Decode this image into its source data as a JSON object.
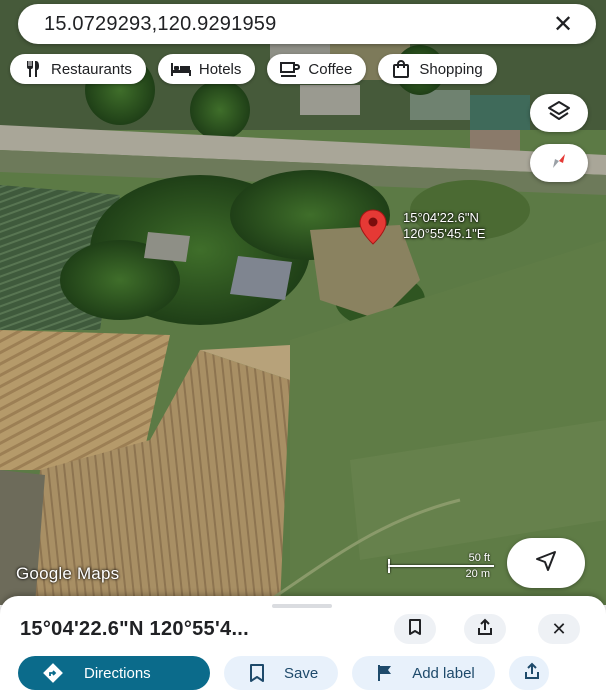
{
  "search": {
    "query": "15.0729293,120.9291959"
  },
  "chips": [
    {
      "label": "Restaurants",
      "icon": "fork-knife-icon"
    },
    {
      "label": "Hotels",
      "icon": "bed-icon"
    },
    {
      "label": "Coffee",
      "icon": "coffee-cup-icon"
    },
    {
      "label": "Shopping",
      "icon": "shopping-bag-icon"
    }
  ],
  "marker": {
    "lat_dms": "15°04'22.6\"N",
    "lng_dms": "120°55'45.1\"E"
  },
  "map": {
    "attribution": "Google Maps",
    "scale_imperial": "50 ft",
    "scale_metric": "20 m"
  },
  "sheet": {
    "title": "15°04'22.6\"N 120°55'4...",
    "actions": [
      {
        "label": "Directions",
        "icon": "directions-icon"
      },
      {
        "label": "Save",
        "icon": "bookmark-icon"
      },
      {
        "label": "Add label",
        "icon": "flag-icon"
      }
    ]
  },
  "colors": {
    "primary": "#0b6b8b",
    "secondary_bg": "#e8f1fb",
    "marker": "#e53935"
  }
}
